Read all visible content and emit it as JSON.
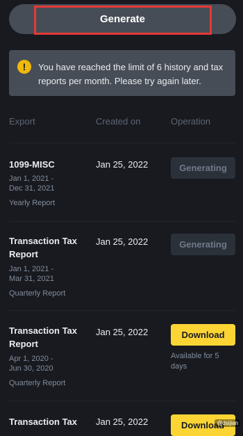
{
  "generate_button": {
    "label": "Generate"
  },
  "alert": {
    "icon": "exclamation-icon",
    "message": "You have reached the limit of 6 history and tax reports per month. Please try again later."
  },
  "table": {
    "headers": {
      "export": "Export",
      "created_on": "Created on",
      "operation": "Operation"
    },
    "rows": [
      {
        "title_line1": "1099-MISC",
        "title_line2": "",
        "period_line1": "Jan 1, 2021 -",
        "period_line2": "Dec 31, 2021",
        "type": "Yearly Report",
        "created_on": "Jan 25, 2022",
        "operation": "Generating",
        "note": ""
      },
      {
        "title_line1": "Transaction Tax",
        "title_line2": "Report",
        "period_line1": "Jan 1, 2021 -",
        "period_line2": "Mar 31, 2021",
        "type": "Quarterly Report",
        "created_on": "Jan 25, 2022",
        "operation": "Generating",
        "note": ""
      },
      {
        "title_line1": "Transaction Tax",
        "title_line2": "Report",
        "period_line1": "Apr 1, 2020 -",
        "period_line2": "Jun 30, 2020",
        "type": "Quarterly Report",
        "created_on": "Jan 25, 2022",
        "operation": "Download",
        "note": "Available for 5 days"
      },
      {
        "title_line1": "Transaction Tax",
        "title_line2": "",
        "period_line1": "",
        "period_line2": "",
        "type": "",
        "created_on": "Jan 25, 2022",
        "operation": "Download",
        "note": ""
      }
    ]
  },
  "colors": {
    "background": "#181a20",
    "accent_yellow": "#fcd535",
    "highlight_red": "#e53935"
  },
  "watermark": "@dsijian"
}
